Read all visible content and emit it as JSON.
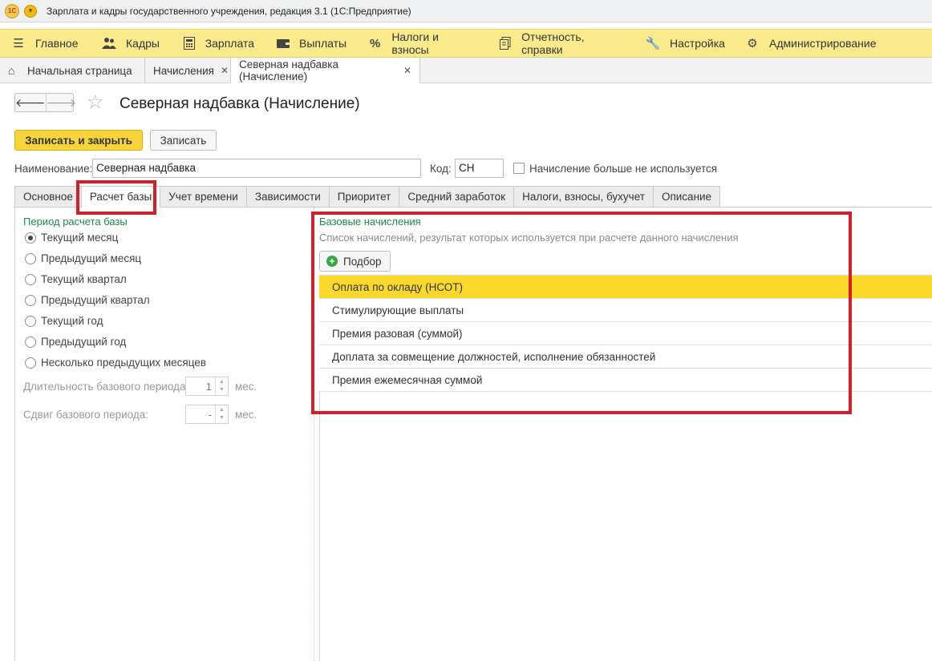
{
  "window": {
    "title": "Зарплата и кадры государственного учреждения, редакция 3.1  (1С:Предприятие)",
    "logo_text": "1С"
  },
  "menu": {
    "items": [
      {
        "label": "Главное",
        "icon": "hamburger-icon"
      },
      {
        "label": "Кадры",
        "icon": "people-icon"
      },
      {
        "label": "Зарплата",
        "icon": "calculator-icon"
      },
      {
        "label": "Выплаты",
        "icon": "wallet-icon"
      },
      {
        "label": "Налоги и взносы",
        "icon": "percent-icon"
      },
      {
        "label": "Отчетность, справки",
        "icon": "report-icon"
      },
      {
        "label": "Настройка",
        "icon": "wrench-icon"
      },
      {
        "label": "Администрирование",
        "icon": "gear-icon"
      }
    ]
  },
  "window_tabs": [
    {
      "label": "Начальная страница"
    },
    {
      "label": "Начисления"
    },
    {
      "label": "Северная надбавка (Начисление)"
    }
  ],
  "form": {
    "title": "Северная надбавка (Начисление)",
    "save_close_label": "Записать и закрыть",
    "save_label": "Записать",
    "name_label": "Наименование:",
    "name_value": "Северная надбавка",
    "code_label": "Код:",
    "code_value": "СН",
    "not_used_label": "Начисление больше не используется",
    "not_used_checked": false
  },
  "form_tabs": [
    "Основное",
    "Расчет базы",
    "Учет времени",
    "Зависимости",
    "Приоритет",
    "Средний заработок",
    "Налоги, взносы, бухучет",
    "Описание"
  ],
  "active_form_tab": "Расчет базы",
  "period": {
    "title": "Период расчета базы",
    "options": [
      {
        "label": "Текущий месяц",
        "selected": true
      },
      {
        "label": "Предыдущий месяц",
        "selected": false
      },
      {
        "label": "Текущий квартал",
        "selected": false
      },
      {
        "label": "Предыдущий квартал",
        "selected": false
      },
      {
        "label": "Текущий год",
        "selected": false
      },
      {
        "label": "Предыдущий год",
        "selected": false
      },
      {
        "label": "Несколько предыдущих месяцев",
        "selected": false
      }
    ],
    "duration_label": "Длительность базового периода:",
    "duration_value": "1",
    "duration_unit": "мес.",
    "shift_label": "Сдвиг базового периода:",
    "shift_value": "-",
    "shift_unit": "мес."
  },
  "base": {
    "title": "Базовые начисления",
    "description": "Список начислений, результат которых используется при расчете данного начисления",
    "pick_label": "Подбор",
    "items": [
      {
        "label": "Оплата по окладу (НСОТ)",
        "selected": true
      },
      {
        "label": "Стимулирующие выплаты",
        "selected": false
      },
      {
        "label": "Премия разовая (суммой)",
        "selected": false
      },
      {
        "label": "Доплата за совмещение должностей, исполнение обязанностей",
        "selected": false
      },
      {
        "label": "Премия ежемесячная суммой",
        "selected": false
      }
    ]
  },
  "colors": {
    "menu_bg": "#fbeb8c",
    "accent_yellow": "#f7d53a",
    "selected_row": "#fbd92a",
    "section_green": "#1a8a4b",
    "highlight_red": "#d1202a"
  }
}
